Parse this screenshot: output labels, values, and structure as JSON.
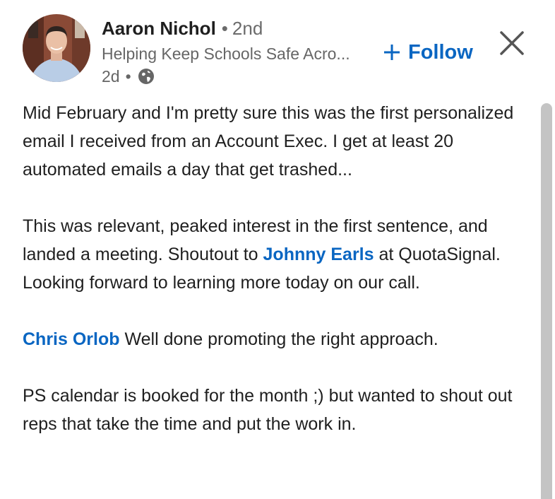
{
  "author": {
    "name": "Aaron Nichol",
    "separator": "•",
    "degree": "2nd",
    "headline": "Helping Keep Schools Safe Acro...",
    "time": "2d",
    "meta_separator": "•",
    "visibility_icon": "globe-icon",
    "avatar_icon": "profile-photo"
  },
  "actions": {
    "follow_label": "Follow",
    "follow_icon": "plus-icon",
    "close_icon": "close-icon"
  },
  "post": {
    "p1": "Mid February and I'm pretty sure this was the first personalized email I received from an Account Exec. I get at least 20 automated emails a day that get trashed...",
    "p2_before": "This was relevant, peaked interest in the first sentence, and landed a meeting. Shoutout to ",
    "p2_mention": "Johnny Earls",
    "p2_after": " at QuotaSignal. Looking forward to learning more today on our call.",
    "p3_mention": "Chris Orlob",
    "p3_after": " Well done promoting the right approach.",
    "p4": "PS calendar is booked for the month ;) but wanted to shout out reps that take the time and put the work in."
  },
  "colors": {
    "accent": "#0a66c2",
    "text": "#1f1f1f",
    "muted": "#666666",
    "scrollbar": "#c4c4c4"
  }
}
